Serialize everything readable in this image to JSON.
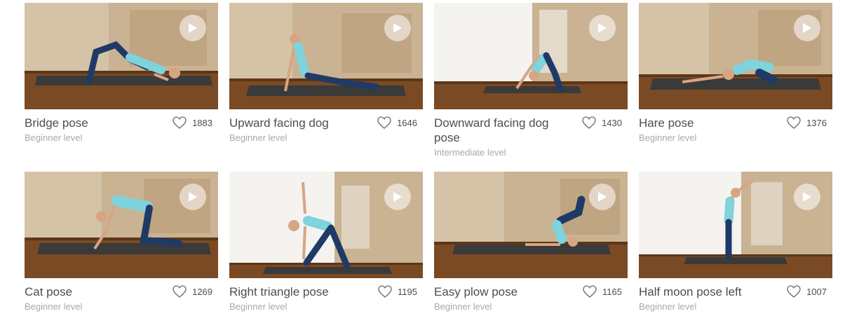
{
  "cards": [
    {
      "title": "Bridge pose",
      "level": "Beginner level",
      "likes": "1883",
      "wall": "brick"
    },
    {
      "title": "Upward facing dog",
      "level": "Beginner level",
      "likes": "1646",
      "wall": "brick"
    },
    {
      "title": "Downward facing dog pose",
      "level": "Intermediate level",
      "likes": "1430",
      "wall": "white"
    },
    {
      "title": "Hare pose",
      "level": "Beginner level",
      "likes": "1376",
      "wall": "brick"
    },
    {
      "title": "Cat pose",
      "level": "Beginner level",
      "likes": "1269",
      "wall": "brick"
    },
    {
      "title": "Right triangle pose",
      "level": "Beginner level",
      "likes": "1195",
      "wall": "white"
    },
    {
      "title": "Easy plow pose",
      "level": "Beginner level",
      "likes": "1165",
      "wall": "brick"
    },
    {
      "title": "Half moon pose left",
      "level": "Beginner level",
      "likes": "1007",
      "wall": "white"
    }
  ],
  "colors": {
    "brick": "#c9b393",
    "white_wall": "#f4f3f0",
    "floor": "#7a4a24",
    "mat": "#3a3a3a",
    "top": "#7fd3dd",
    "pants": "#1f3a66",
    "skin": "#d8a583"
  }
}
